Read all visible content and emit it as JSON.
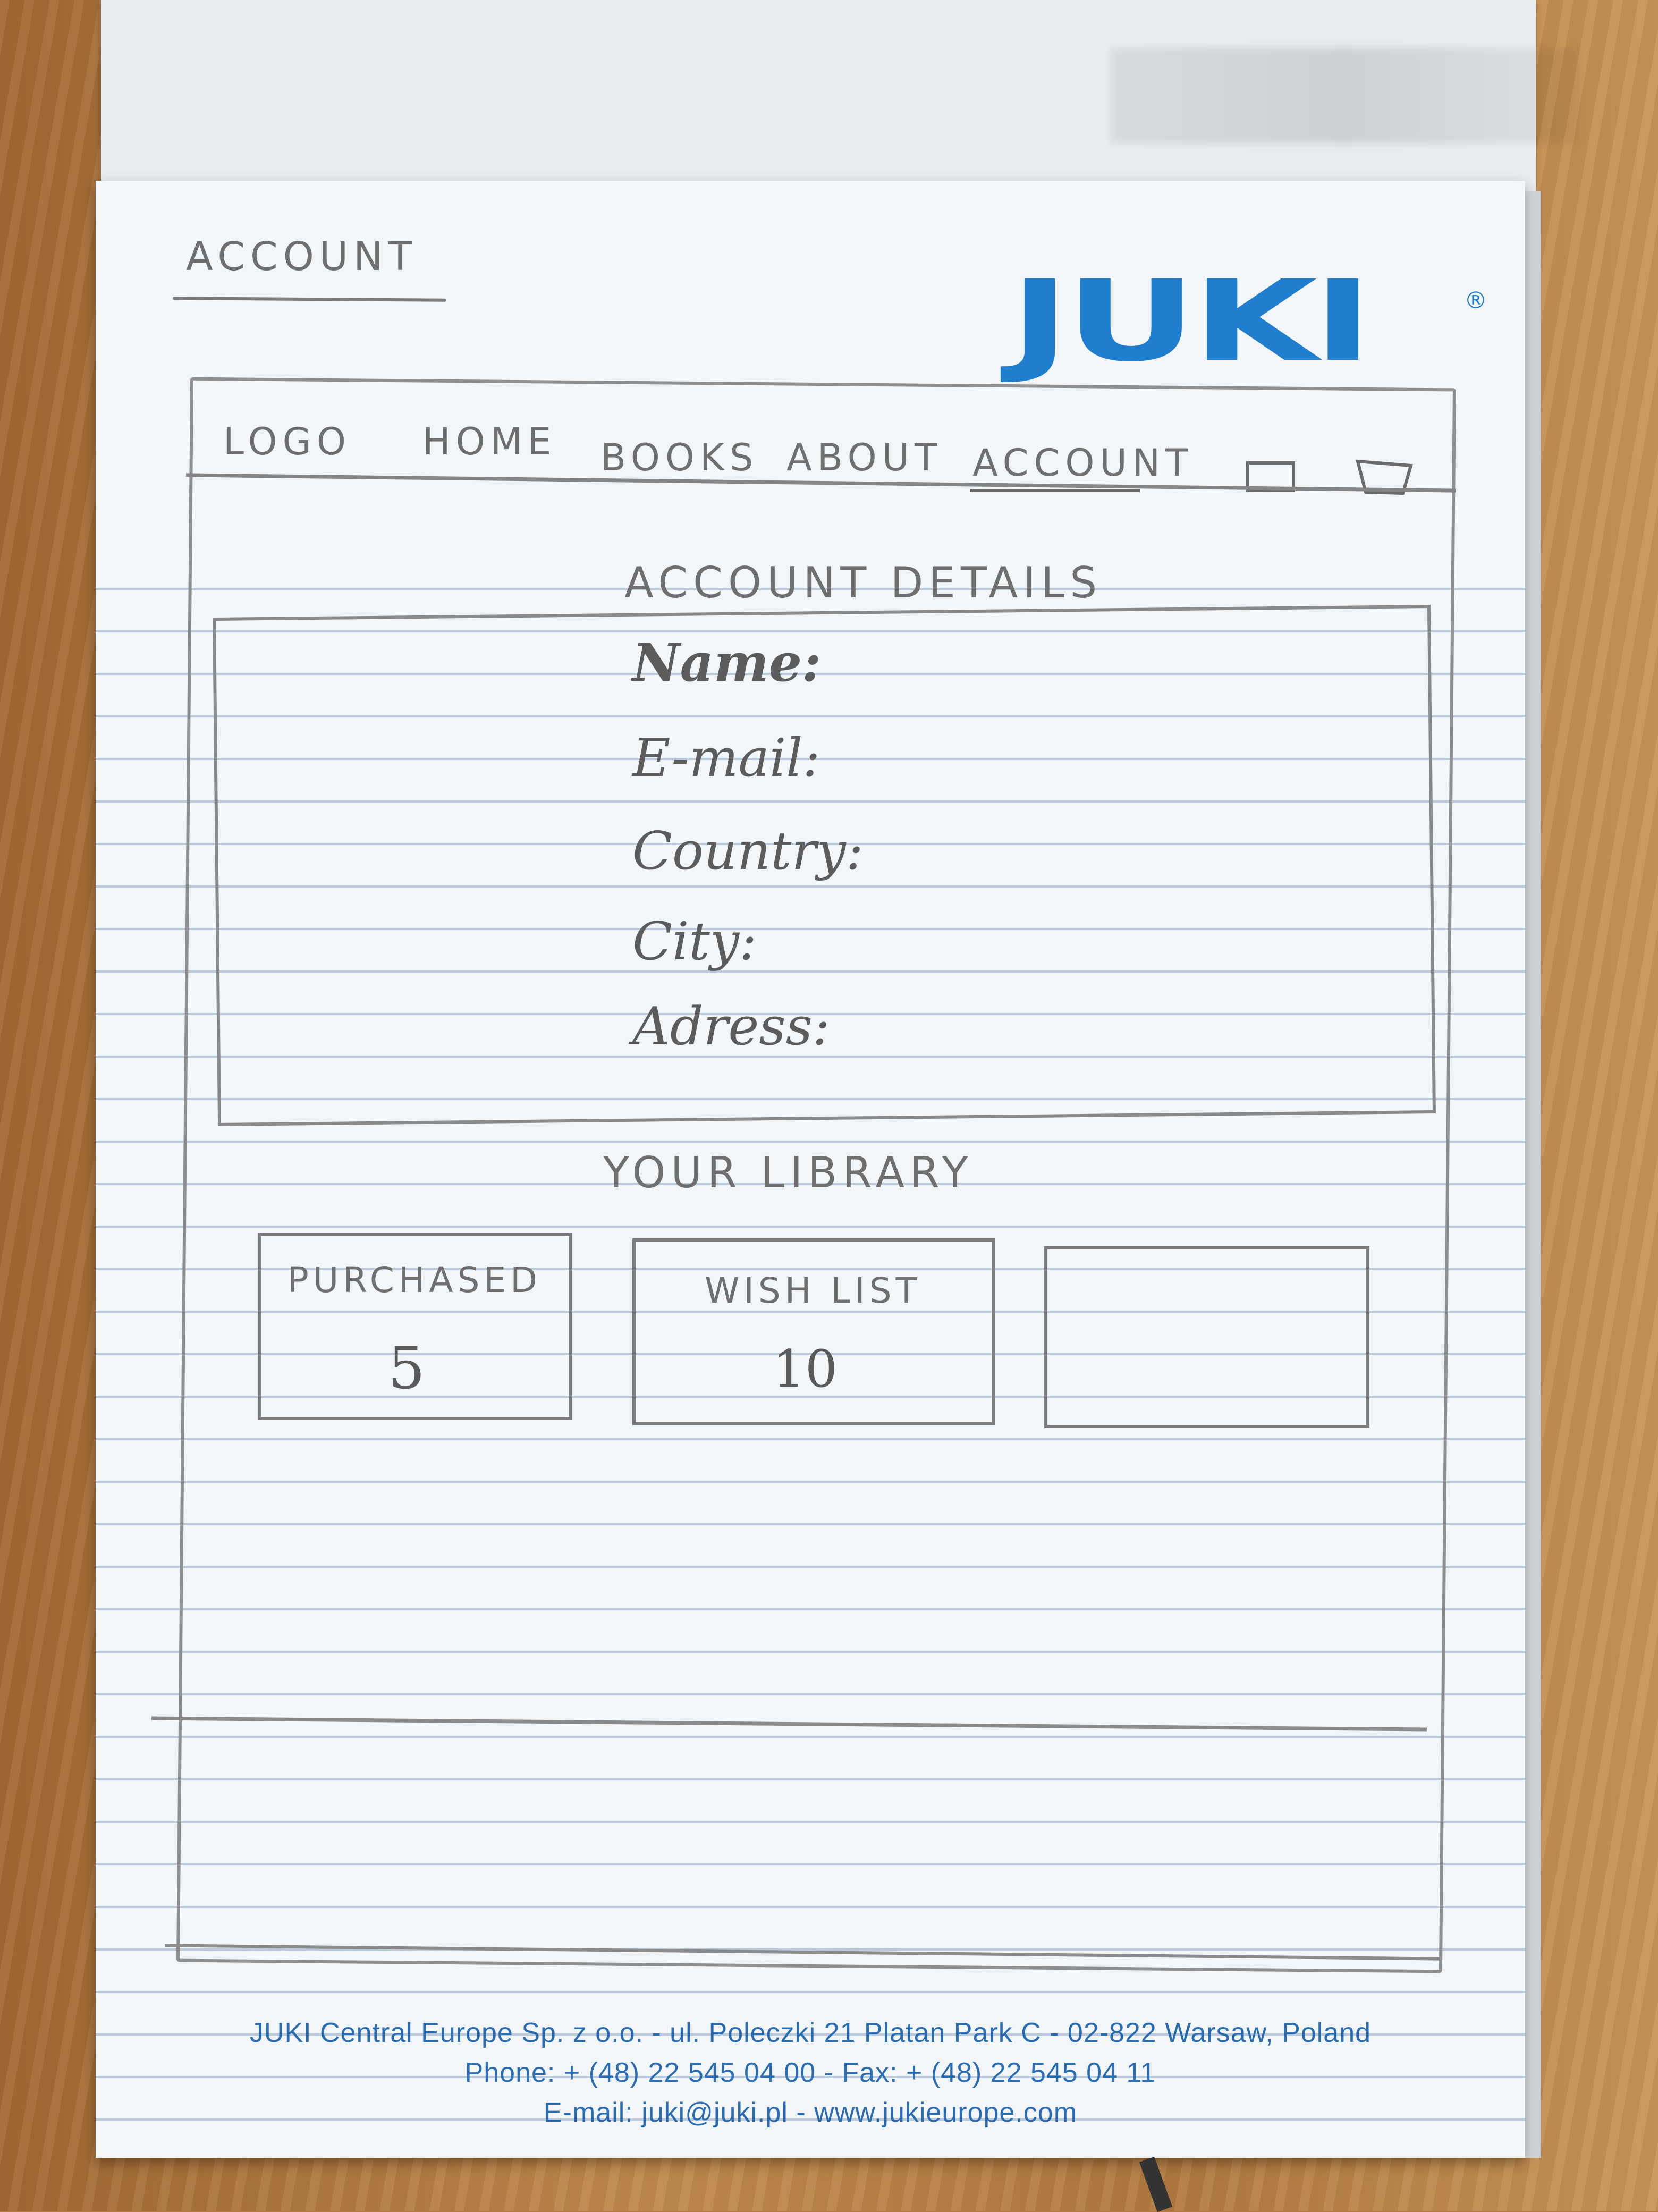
{
  "sketch": {
    "title": "ACCOUNT",
    "nav": {
      "logo": "LOGO",
      "items": [
        "HOME",
        "BOOKS",
        "ABOUT",
        "ACCOUNT"
      ],
      "active": "ACCOUNT",
      "icons": [
        "square-icon",
        "cart-icon"
      ]
    },
    "account_details": {
      "heading": "ACCOUNT DETAILS",
      "fields": [
        "Name:",
        "E-mail:",
        "Country:",
        "City:",
        "Adress:"
      ]
    },
    "library": {
      "heading": "YOUR LIBRARY",
      "cards": [
        {
          "label": "PURCHASED",
          "value": "5"
        },
        {
          "label": "WISH LIST",
          "value": "10"
        },
        {
          "label": "",
          "value": ""
        }
      ]
    }
  },
  "notepad": {
    "brand": "JUKI",
    "brand_mark": "®",
    "brand_color": "#1f7fce",
    "footer_lines": [
      "JUKI Central Europe Sp. z o.o.  -  ul. Poleczki 21 Platan Park C  -  02-822 Warsaw, Poland",
      "Phone: + (48) 22 545 04 00  -  Fax: + (48) 22 545 04 11",
      "E-mail: juki@juki.pl  -  www.jukieurope.com"
    ],
    "footer_color": "#2a6cb3"
  }
}
